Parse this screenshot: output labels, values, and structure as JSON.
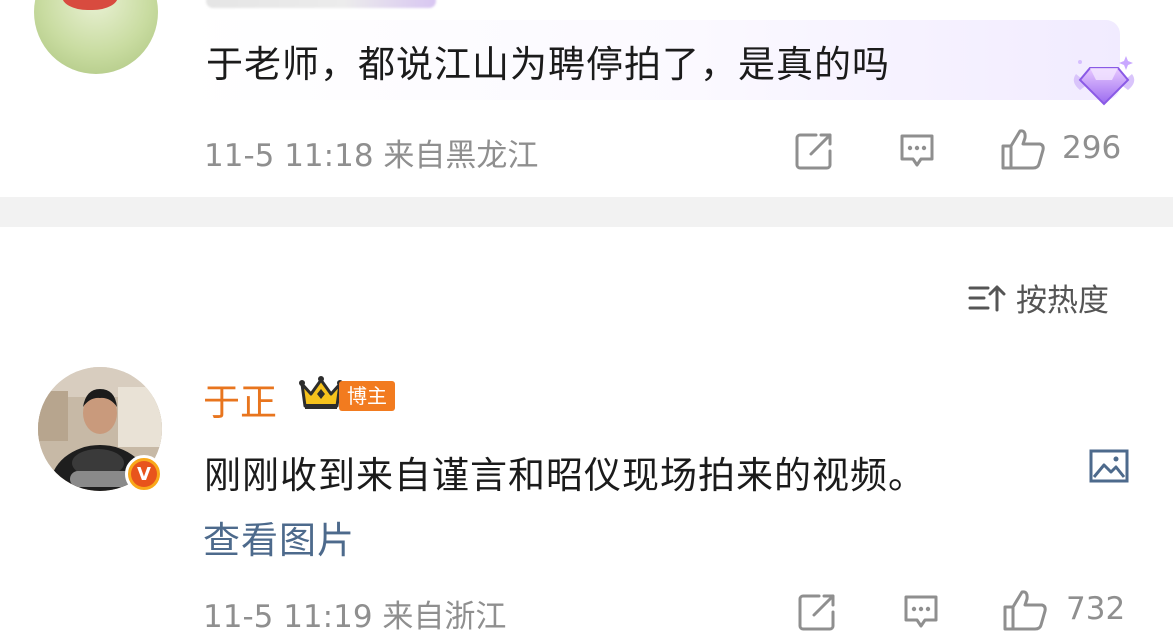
{
  "comments": [
    {
      "text": "于老师，都说江山为聘停拍了，是真的吗",
      "time": "11-5 11:18",
      "location": "来自黑龙江",
      "likes": "296"
    },
    {
      "author": "于正",
      "badge": "博主",
      "verified_mark": "V",
      "text": "刚刚收到来自谨言和昭仪现场拍来的视频。",
      "link": "查看图片",
      "time": "11-5 11:19",
      "location": "来自浙江",
      "likes": "732"
    }
  ],
  "sort": {
    "label": "按热度"
  },
  "colors": {
    "username": "#e8751e",
    "link": "#4d6a8c",
    "meta": "#8f8f8f",
    "badge_bg": "#f27b1f",
    "separator": "#f2f2f2"
  },
  "icons": [
    "share-icon",
    "comment-icon",
    "like-icon",
    "sort-icon",
    "image-icon",
    "crown-icon",
    "gem-badge-icon"
  ]
}
